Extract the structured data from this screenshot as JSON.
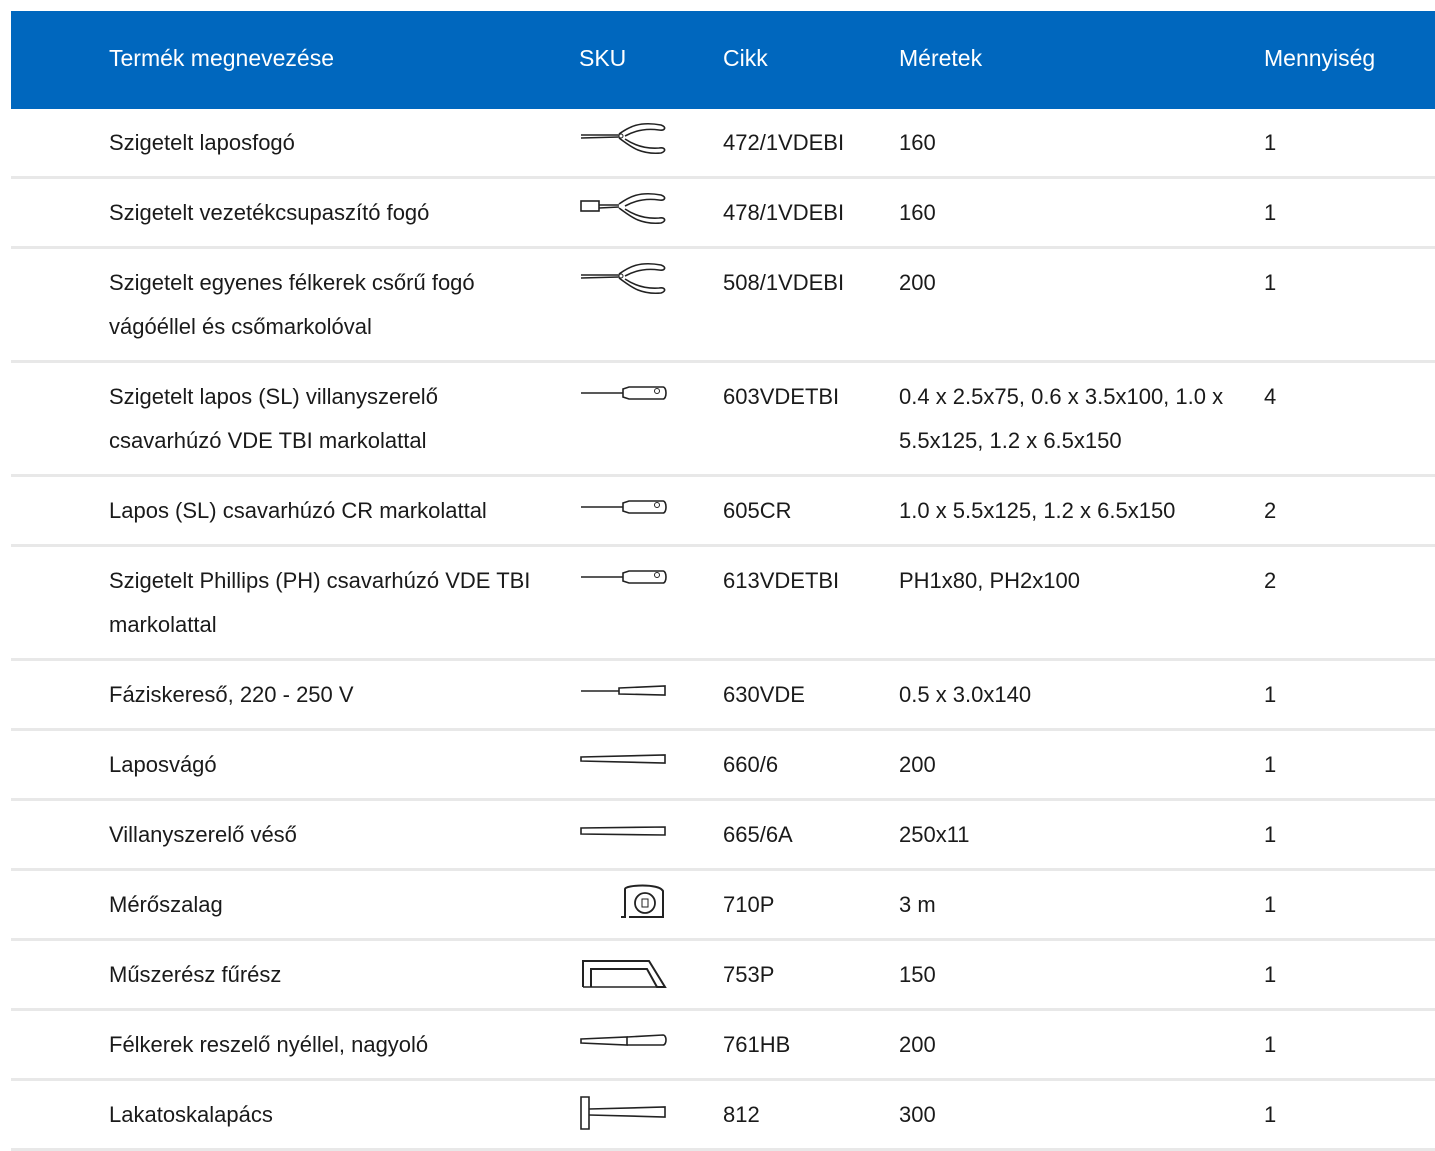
{
  "header": {
    "name": "Termék megnevezése",
    "sku": "SKU",
    "cikk": "Cikk",
    "dims": "Méretek",
    "qty": "Mennyiség"
  },
  "rows": [
    {
      "name": "Szigetelt laposfogó",
      "icon": "pliers-icon",
      "cikk": "472/1VDEBI",
      "dims": "160",
      "qty": "1"
    },
    {
      "name": "Szigetelt vezetékcsupaszító fogó",
      "icon": "wire-stripper-icon",
      "cikk": "478/1VDEBI",
      "dims": "160",
      "qty": "1"
    },
    {
      "name": "Szigetelt egyenes félkerek csőrű fogó vágóéllel és csőmarkolóval",
      "icon": "pliers-icon",
      "cikk": "508/1VDEBI",
      "dims": "200",
      "qty": "1"
    },
    {
      "name": "Szigetelt lapos (SL) villanyszerelő csavarhúzó VDE TBI markolattal",
      "icon": "screwdriver-icon",
      "cikk": "603VDETBI",
      "dims": "0.4 x 2.5x75, 0.6 x 3.5x100, 1.0 x 5.5x125, 1.2 x 6.5x150",
      "qty": "4"
    },
    {
      "name": "Lapos (SL) csavarhúzó CR markolattal",
      "icon": "screwdriver-icon",
      "cikk": "605CR",
      "dims": "1.0 x 5.5x125, 1.2 x 6.5x150",
      "qty": "2"
    },
    {
      "name": "Szigetelt Phillips (PH) csavarhúzó VDE TBI markolattal",
      "icon": "screwdriver-icon",
      "cikk": "613VDETBI",
      "dims": "PH1x80, PH2x100",
      "qty": "2"
    },
    {
      "name": "Fáziskereső, 220 - 250 V",
      "icon": "voltage-tester-icon",
      "cikk": "630VDE",
      "dims": "0.5 x 3.0x140",
      "qty": "1"
    },
    {
      "name": "Laposvágó",
      "icon": "flat-chisel-icon",
      "cikk": "660/6",
      "dims": "200",
      "qty": "1"
    },
    {
      "name": "Villanyszerelő véső",
      "icon": "chisel-icon",
      "cikk": "665/6A",
      "dims": "250x11",
      "qty": "1"
    },
    {
      "name": "Mérőszalag",
      "icon": "tape-measure-icon",
      "cikk": "710P",
      "dims": "3 m",
      "qty": "1"
    },
    {
      "name": "Műszerész fűrész",
      "icon": "hacksaw-icon",
      "cikk": "753P",
      "dims": "150",
      "qty": "1"
    },
    {
      "name": "Félkerek reszelő nyéllel, nagyoló",
      "icon": "file-icon",
      "cikk": "761HB",
      "dims": "200",
      "qty": "1"
    },
    {
      "name": "Lakatoskalapács",
      "icon": "hammer-icon",
      "cikk": "812",
      "dims": "300",
      "qty": "1"
    }
  ]
}
